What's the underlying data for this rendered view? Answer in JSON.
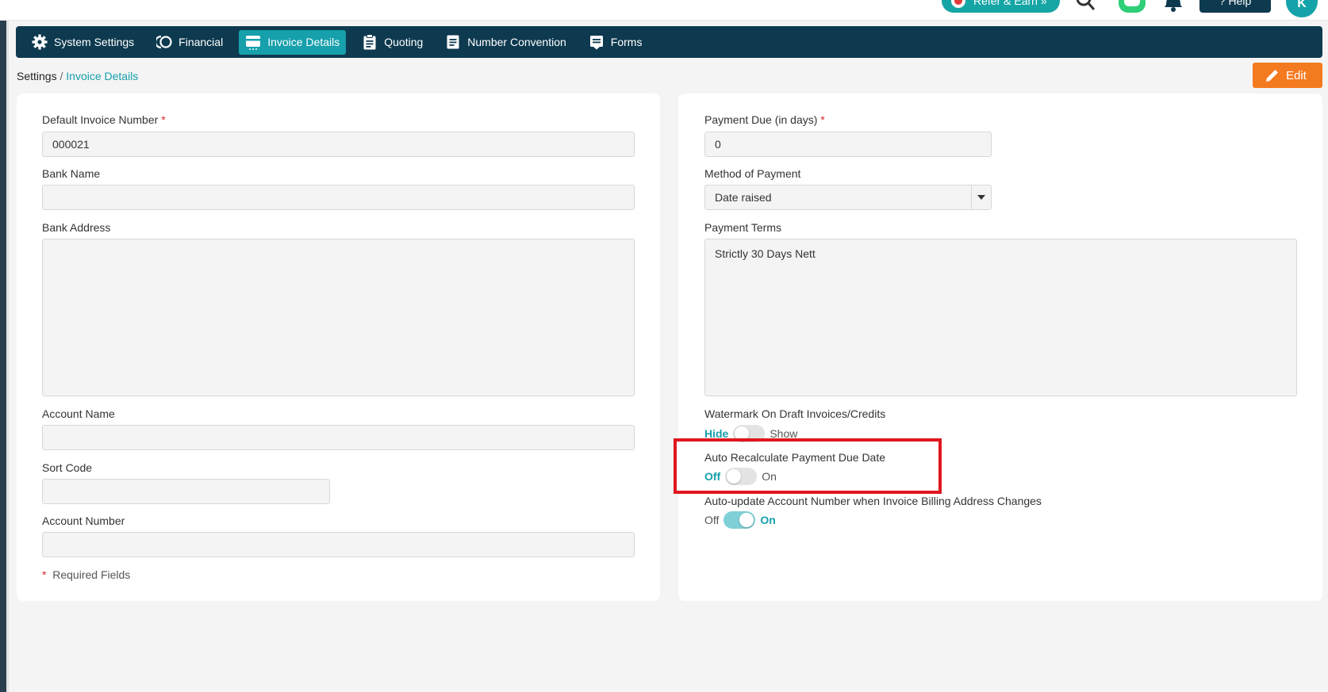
{
  "header": {
    "refer_label": "Refer & Earn »",
    "help_label": "? Help",
    "avatar_initial": "K"
  },
  "nav": {
    "items": [
      {
        "label": "System Settings",
        "icon": "gear-icon"
      },
      {
        "label": "Financial",
        "icon": "financial-icon"
      },
      {
        "label": "Invoice Details",
        "icon": "invoice-card-icon",
        "active": true
      },
      {
        "label": "Quoting",
        "icon": "clipboard-icon"
      },
      {
        "label": "Number Convention",
        "icon": "document-icon"
      },
      {
        "label": "Forms",
        "icon": "form-icon"
      }
    ]
  },
  "breadcrumb": {
    "root": "Settings",
    "separator": " / ",
    "current": "Invoice Details"
  },
  "edit_label": "Edit",
  "left_panel": {
    "default_invoice_number": {
      "label": "Default Invoice Number",
      "required": "*",
      "value": "000021"
    },
    "bank_name": {
      "label": "Bank Name",
      "value": ""
    },
    "bank_address": {
      "label": "Bank Address",
      "value": ""
    },
    "account_name": {
      "label": "Account Name",
      "value": ""
    },
    "sort_code": {
      "label": "Sort Code",
      "value": ""
    },
    "account_number": {
      "label": "Account Number",
      "value": ""
    },
    "required_note": {
      "star": "*",
      "text": "Required Fields"
    }
  },
  "right_panel": {
    "payment_due": {
      "label": "Payment Due (in days)",
      "required": "*",
      "value": "0"
    },
    "method_of_payment": {
      "label": "Method of Payment",
      "value": "Date raised"
    },
    "payment_terms": {
      "label": "Payment Terms",
      "value": "Strictly 30 Days Nett"
    },
    "watermark": {
      "label": "Watermark On Draft Invoices/Credits",
      "left": "Hide",
      "right": "Show",
      "state": "off"
    },
    "auto_recalc": {
      "label": "Auto Recalculate Payment Due Date",
      "left": "Off",
      "right": "On",
      "state": "off"
    },
    "auto_update": {
      "label": "Auto-update Account Number when Invoice Billing Address Changes",
      "left": "Off",
      "right": "On",
      "state": "on"
    }
  },
  "colors": {
    "navbar": "#0e3a4f",
    "accent": "#16a0ac",
    "edit_button": "#f47a20",
    "highlight": "#e0161e"
  }
}
